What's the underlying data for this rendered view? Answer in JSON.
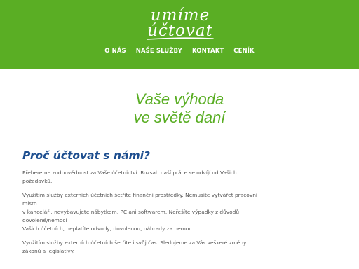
{
  "colors": {
    "brand_green": "#5aae24",
    "heading_blue": "#1d4e8f",
    "body_text": "#555555"
  },
  "logo": {
    "line1": "umíme",
    "line2": "účtovat"
  },
  "nav": {
    "items": [
      {
        "label": "O NÁS"
      },
      {
        "label": "NAŠE SLUŽBY"
      },
      {
        "label": "KONTAKT"
      },
      {
        "label": "CENÍK"
      }
    ]
  },
  "hero": {
    "line1": "Vaše výhoda",
    "line2": "ve světě daní"
  },
  "section": {
    "title": "Proč účtovat s námi?",
    "p1": {
      "l1": "Přebereme zodpovědnost za Vaše účetnictví. Rozsah naší práce se odvíjí od Vašich",
      "l2": "požadavků."
    },
    "p2": {
      "l1": "Využitím služby externích účetních šetříte finanční prostředky. Nemusíte vytvářet pracovní",
      "l2": "místo",
      "l3": "v kanceláři, nevybavujete nábytkem, PC ani softwarem. Neřešíte výpadky z důvodů",
      "l4": "dovolené/nemoci",
      "l5": "Vašich účetních, neplatíte odvody, dovolenou, náhrady za nemoc."
    },
    "p3": {
      "l1": "Využitím služby externích účetních šetříte i svůj čas. Sledujeme za Vás veškeré změny",
      "l2": "zákonů a legislativy."
    }
  }
}
